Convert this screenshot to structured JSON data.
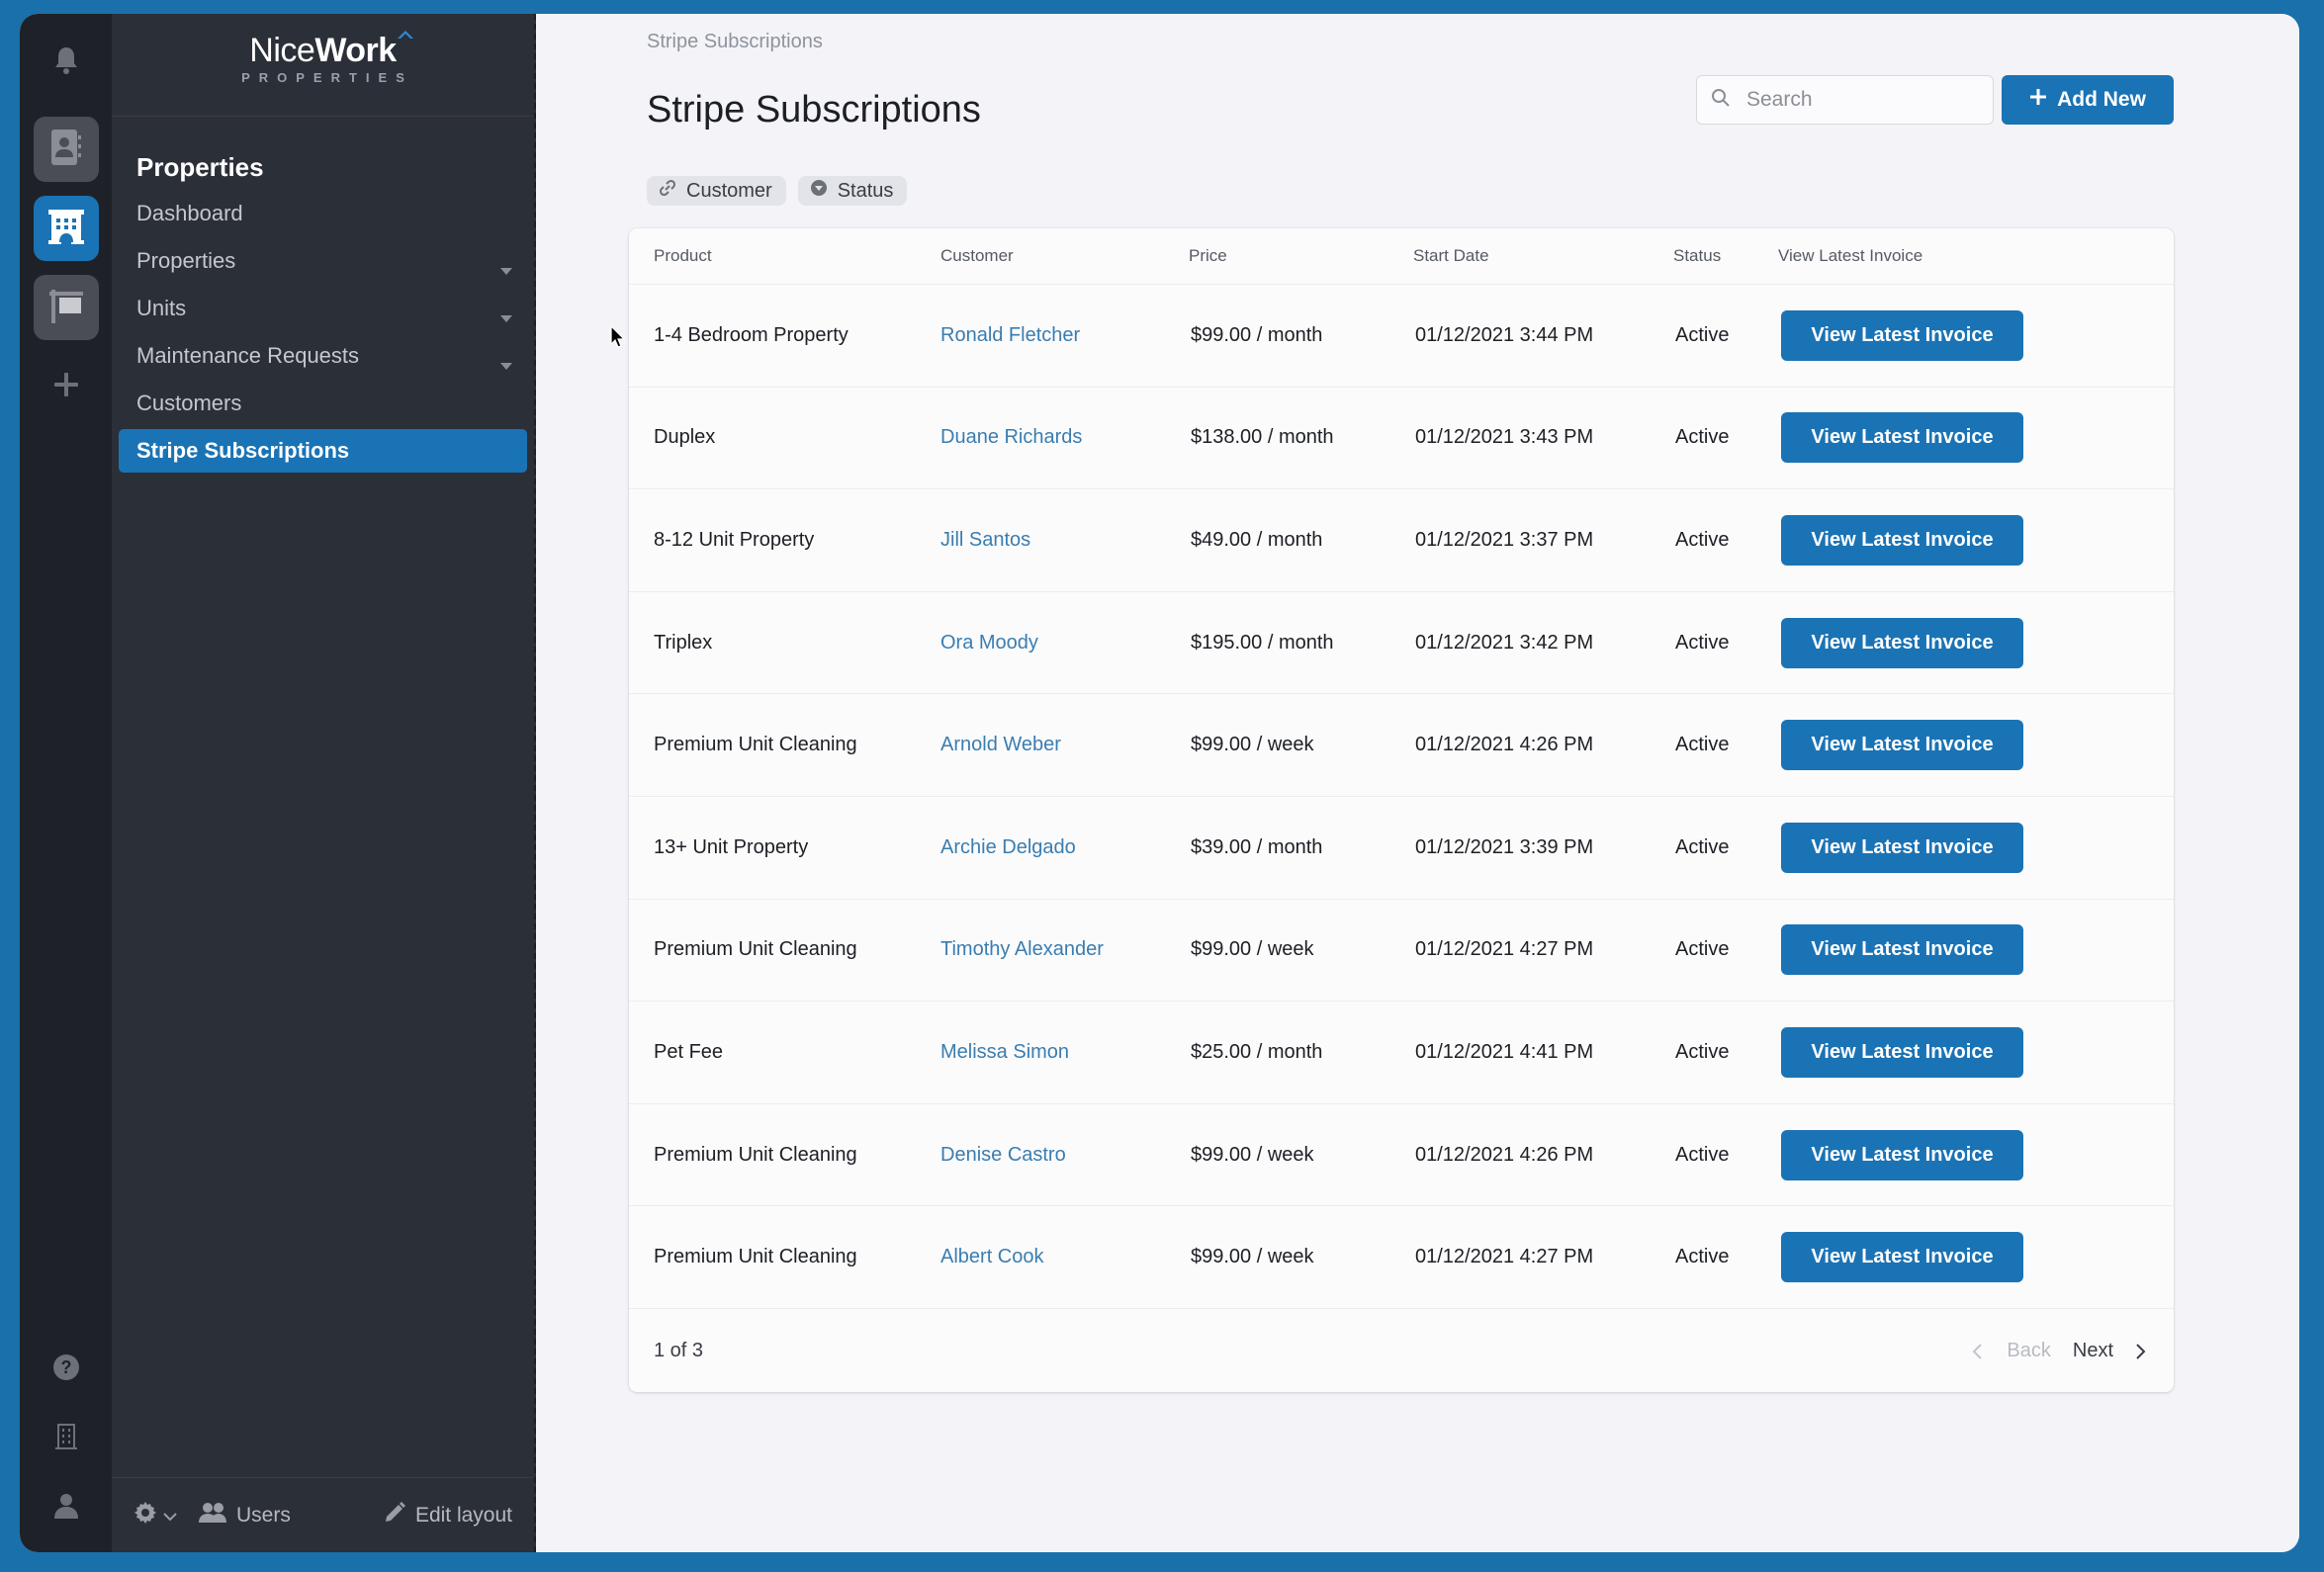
{
  "app": {
    "logo": {
      "primary_light": "Nice",
      "primary_bold": "Work",
      "subtitle": "PROPERTIES"
    },
    "accent_color": "#1a73b5"
  },
  "rail": {
    "top_icons": [
      "bell-icon"
    ],
    "tiles": [
      {
        "name": "contacts-icon",
        "active": false
      },
      {
        "name": "building-icon",
        "active": true
      },
      {
        "name": "sign-icon",
        "active": false
      }
    ],
    "add_icon": "plus-icon",
    "bottom_icons": [
      "help-icon",
      "office-building-icon",
      "user-icon"
    ]
  },
  "nav": {
    "section_title": "Properties",
    "items": [
      {
        "label": "Dashboard",
        "has_chevron": false,
        "active": false
      },
      {
        "label": "Properties",
        "has_chevron": true,
        "active": false
      },
      {
        "label": "Units",
        "has_chevron": true,
        "active": false
      },
      {
        "label": "Maintenance Requests",
        "has_chevron": true,
        "active": false
      },
      {
        "label": "Customers",
        "has_chevron": false,
        "active": false
      },
      {
        "label": "Stripe Subscriptions",
        "has_chevron": false,
        "active": true
      }
    ],
    "footer": {
      "users_label": "Users",
      "edit_layout_label": "Edit layout"
    }
  },
  "main": {
    "breadcrumb": "Stripe Subscriptions",
    "title": "Stripe Subscriptions",
    "search": {
      "placeholder": "Search",
      "value": ""
    },
    "add_new_label": "Add New",
    "filters": [
      {
        "label": "Customer",
        "icon": "link-icon"
      },
      {
        "label": "Status",
        "icon": "chevron-circle-down-icon"
      }
    ],
    "table": {
      "columns": [
        "Product",
        "Customer",
        "Price",
        "Start Date",
        "Status",
        "View Latest Invoice"
      ],
      "rows": [
        {
          "product": "1-4 Bedroom Property",
          "customer": "Ronald Fletcher",
          "price": "$99.00 / month",
          "start_date": "01/12/2021 3:44 PM",
          "status": "Active",
          "action": "View Latest Invoice"
        },
        {
          "product": "Duplex",
          "customer": "Duane Richards",
          "price": "$138.00 / month",
          "start_date": "01/12/2021 3:43 PM",
          "status": "Active",
          "action": "View Latest Invoice"
        },
        {
          "product": "8-12 Unit Property",
          "customer": "Jill Santos",
          "price": "$49.00 / month",
          "start_date": "01/12/2021 3:37 PM",
          "status": "Active",
          "action": "View Latest Invoice"
        },
        {
          "product": "Triplex",
          "customer": "Ora Moody",
          "price": "$195.00 / month",
          "start_date": "01/12/2021 3:42 PM",
          "status": "Active",
          "action": "View Latest Invoice"
        },
        {
          "product": "Premium Unit Cleaning",
          "customer": "Arnold Weber",
          "price": "$99.00 / week",
          "start_date": "01/12/2021 4:26 PM",
          "status": "Active",
          "action": "View Latest Invoice"
        },
        {
          "product": "13+ Unit Property",
          "customer": "Archie Delgado",
          "price": "$39.00 / month",
          "start_date": "01/12/2021 3:39 PM",
          "status": "Active",
          "action": "View Latest Invoice"
        },
        {
          "product": "Premium Unit Cleaning",
          "customer": "Timothy Alexander",
          "price": "$99.00 / week",
          "start_date": "01/12/2021 4:27 PM",
          "status": "Active",
          "action": "View Latest Invoice"
        },
        {
          "product": "Pet Fee",
          "customer": "Melissa Simon",
          "price": "$25.00 / month",
          "start_date": "01/12/2021 4:41 PM",
          "status": "Active",
          "action": "View Latest Invoice"
        },
        {
          "product": "Premium Unit Cleaning",
          "customer": "Denise Castro",
          "price": "$99.00 / week",
          "start_date": "01/12/2021 4:26 PM",
          "status": "Active",
          "action": "View Latest Invoice"
        },
        {
          "product": "Premium Unit Cleaning",
          "customer": "Albert Cook",
          "price": "$99.00 / week",
          "start_date": "01/12/2021 4:27 PM",
          "status": "Active",
          "action": "View Latest Invoice"
        }
      ]
    },
    "pagination": {
      "page_text": "1 of 3",
      "back_label": "Back",
      "next_label": "Next",
      "back_disabled": true
    }
  },
  "chat_widget": {
    "icon": "chat-bubble-icon"
  }
}
